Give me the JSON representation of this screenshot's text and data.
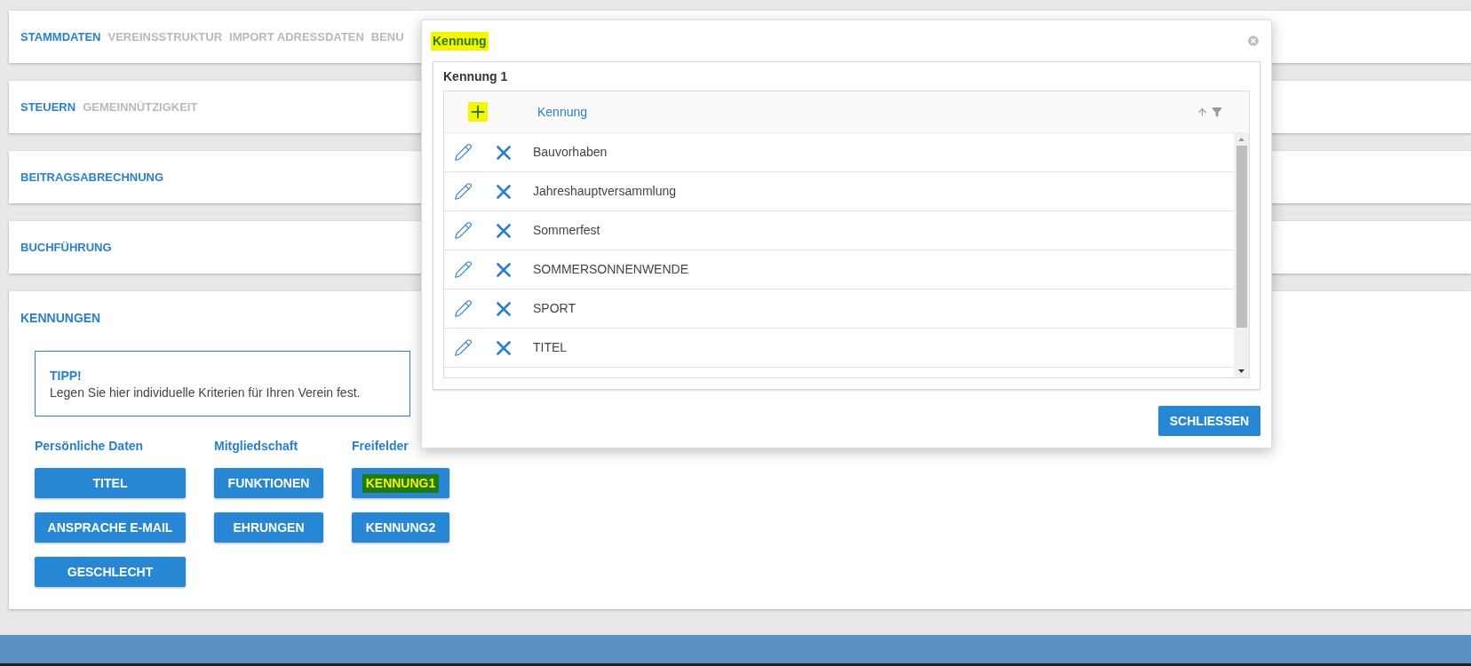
{
  "sections": [
    {
      "tabs": [
        {
          "label": "STAMMDATEN",
          "selected": true
        },
        {
          "label": "VEREINSSTRUKTUR",
          "selected": false
        },
        {
          "label": "IMPORT ADRESSDATEN",
          "selected": false
        },
        {
          "label": "BENU",
          "selected": false
        }
      ]
    },
    {
      "tabs": [
        {
          "label": "STEUERN",
          "selected": true
        },
        {
          "label": "GEMEINNÜTZIGKEIT",
          "selected": false
        }
      ]
    },
    {
      "tabs": [
        {
          "label": "BEITRAGSABRECHNUNG",
          "selected": true
        }
      ]
    },
    {
      "tabs": [
        {
          "label": "BUCHFÜHRUNG",
          "selected": true
        }
      ]
    }
  ],
  "kennungen": {
    "title": "KENNUNGEN",
    "tip": {
      "heading": "TIPP!",
      "text": "Legen Sie hier individuelle Kriterien für Ihren Verein fest."
    },
    "groups": [
      {
        "heading": "Persönliche Daten",
        "buttons": [
          {
            "label": "TITEL",
            "highlighted": false
          },
          {
            "label": "ANSPRACHE E-MAIL",
            "highlighted": false
          },
          {
            "label": "GESCHLECHT",
            "highlighted": false
          }
        ]
      },
      {
        "heading": "Mitgliedschaft",
        "buttons": [
          {
            "label": "FUNKTIONEN",
            "highlighted": false
          },
          {
            "label": "EHRUNGEN",
            "highlighted": false
          }
        ]
      },
      {
        "heading": "Freifelder",
        "buttons": [
          {
            "label": "KENNUNG1",
            "highlighted": true
          },
          {
            "label": "KENNUNG2",
            "highlighted": false
          }
        ]
      }
    ]
  },
  "dialog": {
    "title": {
      "text": "Kennung",
      "highlighted": true
    },
    "panel_title": "Kennung 1",
    "grid": {
      "add_highlighted": true,
      "column": "Kennung",
      "rows": [
        "Bauvorhaben",
        "Jahreshauptversammlung",
        "Sommerfest",
        "SOMMERSONNENWENDE",
        "SPORT",
        "TITEL"
      ]
    },
    "close_button": "SCHLIESSEN"
  }
}
